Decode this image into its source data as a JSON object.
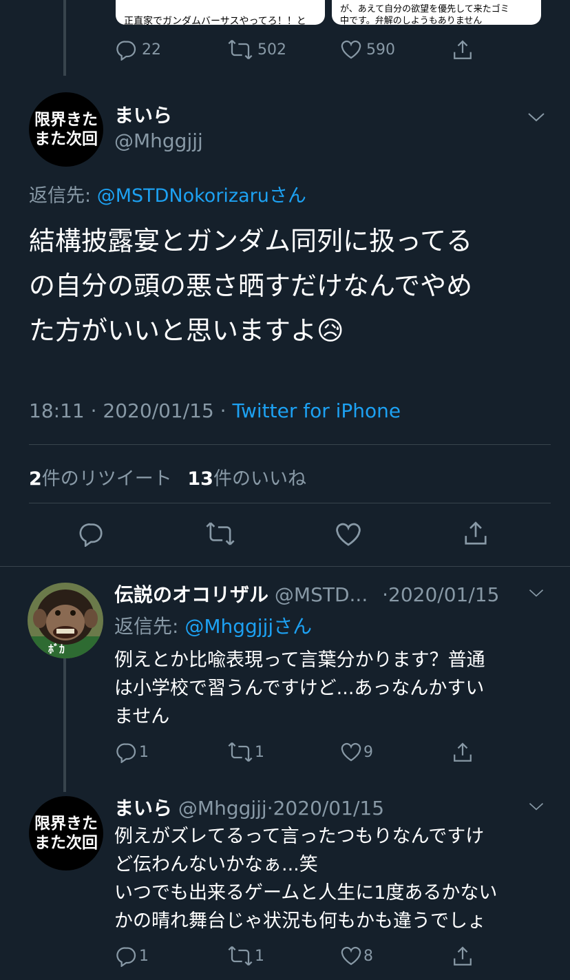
{
  "top_tweet": {
    "card_left_text": "正直家でガンダムバーサスやってろ！！と",
    "card_right_line1": "が、あえて自分の欲望を優先して来たゴミ",
    "card_right_line2": "中です。弁解のしようもありません",
    "replies": "22",
    "retweets": "502",
    "likes": "590"
  },
  "main_tweet": {
    "avatar_line1": "限界きた",
    "avatar_line2": "また次回",
    "display_name": "まいら",
    "handle": "@Mhggjjj",
    "reply_prefix": "返信先: ",
    "reply_to": "@MSTDNokorizaruさん",
    "text_line1": "結構披露宴とガンダム同列に扱ってる",
    "text_line2": "の自分の頭の悪さ晒すだけなんでやめ",
    "text_line3": "た方がいいと思いますよ",
    "emoji": "😥",
    "time": "18:11 · 2020/01/15 · ",
    "source": "Twitter for iPhone",
    "retweet_count": "2",
    "retweet_label": "件のリツイート",
    "like_count": "13",
    "like_label": "件のいいね"
  },
  "reply1": {
    "display_name": "伝説のオコリザル",
    "handle": "@MSTD...",
    "date": "·2020/01/15",
    "reply_prefix": "返信先: ",
    "reply_to": "@Mhggjjjさん",
    "text_line1": "例えとか比喩表現って言葉分かります？普通",
    "text_line2": "は小学校で習うんですけど...あっなんかすい",
    "text_line3": "ません",
    "replies": "1",
    "retweets": "1",
    "likes": "9"
  },
  "reply2": {
    "avatar_line1": "限界きた",
    "avatar_line2": "また次回",
    "display_name": "まいら",
    "handle": "@Mhggjjj",
    "date": "·2020/01/15",
    "text_line1": "例えがズレてるって言ったつもりなんですけ",
    "text_line2": "ど伝わんないかなぁ...笑",
    "text_line3": "いつでも出来るゲームと人生に1度あるかない",
    "text_line4": "かの晴れ舞台じゃ状況も何もかも違うでしょ",
    "replies": "1",
    "retweets": "1",
    "likes": "8"
  },
  "colors": {
    "background": "#15202b",
    "muted": "#8899a6",
    "link": "#1da1f2",
    "divider": "#38444d"
  }
}
